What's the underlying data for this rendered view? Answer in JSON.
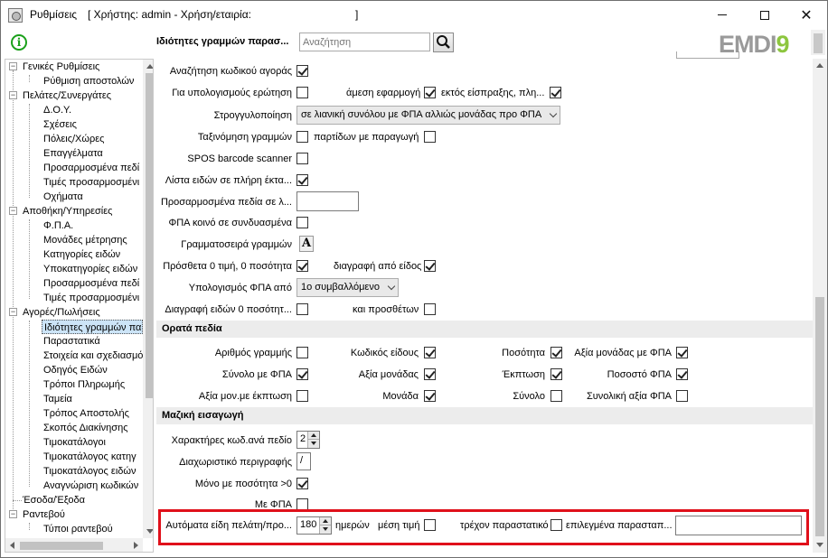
{
  "window": {
    "title": "Ρυθμίσεις",
    "user_info": "[ Χρήστης: admin - Χρήση/εταιρία:",
    "user_info_close": "]",
    "minimize": "—",
    "maximize": "□",
    "close": "✕"
  },
  "toolbar": {
    "info_icon": "info-icon",
    "section_title": "Ιδιότητες γραμμών παρασ...",
    "search_placeholder": "Αναζήτηση",
    "search_icon": "search-icon",
    "logo_part1": "EMDI",
    "logo_part2": "9"
  },
  "tree": {
    "items": [
      {
        "label": "Γενικές Ρυθμίσεις"
      },
      {
        "label": "Ρύθμιση αποστολών"
      },
      {
        "label": "Πελάτες/Συνεργάτες"
      },
      {
        "label": "Δ.Ο.Υ."
      },
      {
        "label": "Σχέσεις"
      },
      {
        "label": "Πόλεις/Χώρες"
      },
      {
        "label": "Επαγγέλματα"
      },
      {
        "label": "Προσαρμοσμένα πεδί"
      },
      {
        "label": "Τιμές προσαρμοσμένι"
      },
      {
        "label": "Οχήματα"
      },
      {
        "label": "Αποθήκη/Υπηρεσίες"
      },
      {
        "label": "Φ.Π.Α."
      },
      {
        "label": "Μονάδες μέτρησης"
      },
      {
        "label": "Κατηγορίες ειδών"
      },
      {
        "label": "Υποκατηγορίες ειδών"
      },
      {
        "label": "Προσαρμοσμένα πεδί"
      },
      {
        "label": "Τιμές προσαρμοσμένι"
      },
      {
        "label": "Αγορές/Πωλήσεις"
      },
      {
        "label": "Ιδιότητες γραμμών πα"
      },
      {
        "label": "Παραστατικά"
      },
      {
        "label": "Στοιχεία και σχεδιασμό"
      },
      {
        "label": "Οδηγός Ειδών"
      },
      {
        "label": "Τρόποι Πληρωμής"
      },
      {
        "label": "Ταμεία"
      },
      {
        "label": "Τρόπος Αποστολής"
      },
      {
        "label": "Σκοπός Διακίνησης"
      },
      {
        "label": "Τιμοκατάλογοι"
      },
      {
        "label": "Τιμοκατάλογος κατηγ"
      },
      {
        "label": "Τιμοκατάλογος ειδών"
      },
      {
        "label": "Αναγνώριση κωδικών"
      },
      {
        "label": "Έσοδα/Έξοδα"
      },
      {
        "label": "Ραντεβού"
      },
      {
        "label": "Τύποι ραντεβού"
      }
    ]
  },
  "settings": {
    "search_barcode": {
      "label": "Αναζήτηση κωδικού αγοράς",
      "checked": true
    },
    "calc_question": {
      "label": "Για υπολογισμούς ερώτηση",
      "checked": false
    },
    "direct_apply": {
      "label": "άμεση εφαρμογή",
      "checked": true
    },
    "except_collection": {
      "label": "εκτός είσπραξης, πλη...",
      "checked": true
    },
    "rounding": {
      "label": "Στρογγυλοποίηση",
      "value": "σε λιανική συνόλου με ΦΠΑ αλλιώς μονάδας προ ΦΠΑ"
    },
    "sort_lines": {
      "label": "Ταξινόμηση γραμμών",
      "checked": false
    },
    "batches_production": {
      "label": "παρτίδων με παραγωγή",
      "checked": false
    },
    "spos_scanner": {
      "label": "SPOS barcode scanner",
      "checked": false
    },
    "item_list_full": {
      "label": "Λίστα ειδών σε πλήρη έκτα...",
      "checked": true
    },
    "custom_fields": {
      "label": "Προσαρμοσμένα πεδία σε λ...",
      "value": ""
    },
    "common_vat": {
      "label": "ΦΠΑ κοινό σε συνδυασμένα",
      "checked": false
    },
    "line_font": {
      "label": "Γραμματοσειρά γραμμών",
      "button": "A"
    },
    "add_zero_price": {
      "label": "Πρόσθετα 0 τιμή,  0 ποσότητα",
      "checked": true
    },
    "delete_from_item": {
      "label": "διαγραφή από είδος",
      "checked": true
    },
    "vat_calc": {
      "label": "Υπολογισμός ΦΠΑ από",
      "value": "1ο συμβαλλόμενο"
    },
    "delete_zero_qty": {
      "label": "Διαγραφή ειδών 0 ποσότητ...",
      "checked": false
    },
    "and_additional": {
      "label": "και προσθέτων",
      "checked": false
    }
  },
  "visible_fields": {
    "header": "Ορατά πεδία",
    "rows": [
      [
        {
          "label": "Αριθμός γραμμής",
          "checked": false
        },
        {
          "label": "Κωδικός είδους",
          "checked": true
        },
        {
          "label": "Ποσότητα",
          "checked": true
        },
        {
          "label": "Αξία μονάδας με ΦΠΑ",
          "checked": true
        }
      ],
      [
        {
          "label": "Σύνολο με ΦΠΑ",
          "checked": true
        },
        {
          "label": "Αξία μονάδας",
          "checked": true
        },
        {
          "label": "Έκπτωση",
          "checked": true
        },
        {
          "label": "Ποσοστό ΦΠΑ",
          "checked": true
        }
      ],
      [
        {
          "label": "Αξία μον.με έκπτωση",
          "checked": false
        },
        {
          "label": "Μονάδα",
          "checked": true
        },
        {
          "label": "Σύνολο",
          "checked": false
        },
        {
          "label": "Συνολική αξία ΦΠΑ",
          "checked": false
        }
      ]
    ]
  },
  "bulk_import": {
    "header": "Μαζική εισαγωγή",
    "chars_per_field": {
      "label": "Χαρακτήρες κωδ.ανά πεδίο",
      "value": "2"
    },
    "separator": {
      "label": "Διαχωριστικό περιγραφής",
      "value": "/"
    },
    "only_qty": {
      "label": "Μόνο με ποσότητα >0",
      "checked": true
    },
    "with_vat": {
      "label": "Με ΦΠΑ",
      "checked": false
    },
    "auto_items": {
      "label": "Αυτόματα είδη πελάτη/προ...",
      "value": "180",
      "unit": "ημερών"
    },
    "avg_price": {
      "label": "μέση τιμή",
      "checked": false
    },
    "current_doc": {
      "label": "τρέχον παραστατικό",
      "checked": false
    },
    "selected_docs": {
      "label": "επιλεγμένα παρασταπ...",
      "value": ""
    }
  }
}
